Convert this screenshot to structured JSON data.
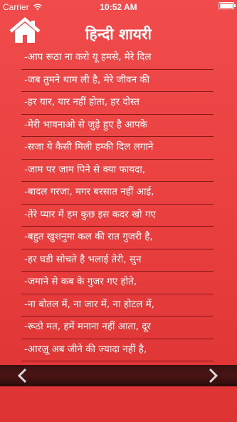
{
  "status": {
    "carrier": "Carrier",
    "time": "10:52 AM",
    "battery_level": 1.0
  },
  "header": {
    "title": "हिन्दी शायरी",
    "home_icon": "home-icon"
  },
  "poems": [
    "-आप रूठा ना करो यू हमसे, मेरे दिल",
    "-जब तुमने थाम ली है, मेरे जीवन की",
    "-हर यार,  यार नहीं होता, हर दोस्त",
    "-मेरी भावनाओ से जुड़े हुए है आपके",
    "-सजा ये कैसी मिली हम्की दिल लगाने",
    "-जाम पर जाम पिने से क्या फायदा,",
    "-बादल गरजा, मगर बरसात नहीं आई,",
    "-तेरे प्यार में हम कुछ इस कदर खो गए",
    "-बहुत खुशनुमा कल की रात गुजरी है,",
    "-हर घडी सोचते है भलाई तेरी, सुन",
    "-जमाने से कब के गुजर गए होते,",
    "-ना बोतल में, ना जार में, ना होटल में,",
    "-रूठो मत, हमें मनाना नहीं आता, दूर",
    "-आरज़ू अब जीने की ज्यादा नहीं है,"
  ],
  "nav": {
    "prev_icon": "chevron-left-icon",
    "next_icon": "chevron-right-icon"
  },
  "colors": {
    "background": "#e83d3d",
    "divider": "#8a1a1a",
    "bottom_bar": "#3a1212",
    "text": "#ffffff"
  }
}
